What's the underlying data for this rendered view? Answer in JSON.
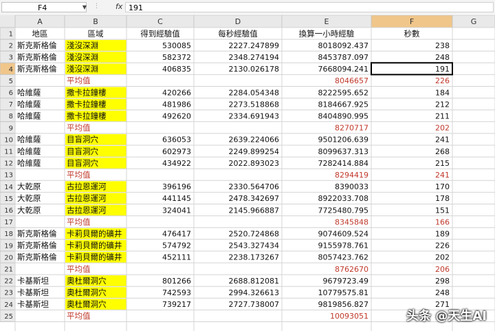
{
  "formula_bar": {
    "name_box": "F4",
    "function_icon": "fx-icon",
    "value": "191"
  },
  "columns": [
    "A",
    "B",
    "C",
    "D",
    "E",
    "F",
    "G"
  ],
  "header_row": [
    "地區",
    "區域",
    "得到經驗值",
    "每秒經驗值",
    "換算一小時經驗",
    "秒數"
  ],
  "rows": [
    {
      "n": "2",
      "a": "斯克斯格倫",
      "b": "淺沒深淵",
      "c": "530085",
      "d": "2227.247899",
      "e": "8018092.437",
      "f": "238",
      "type": "data"
    },
    {
      "n": "3",
      "a": "斯克斯格倫",
      "b": "淺沒深淵",
      "c": "582372",
      "d": "2348.274194",
      "e": "8453787.097",
      "f": "248",
      "type": "data"
    },
    {
      "n": "4",
      "a": "斯克斯格倫",
      "b": "淺沒深淵",
      "c": "406835",
      "d": "2130.026178",
      "e": "7668094.241",
      "f": "191",
      "type": "data"
    },
    {
      "n": "5",
      "a": "",
      "b": "平均值",
      "c": "",
      "d": "",
      "e": "8046657",
      "f": "226",
      "type": "avg"
    },
    {
      "n": "6",
      "a": "哈維薩",
      "b": "撒卡拉鐘樓",
      "c": "420266",
      "d": "2284.054348",
      "e": "8222595.652",
      "f": "184",
      "type": "data"
    },
    {
      "n": "7",
      "a": "哈維薩",
      "b": "撒卡拉鐘樓",
      "c": "481986",
      "d": "2273.518868",
      "e": "8184667.925",
      "f": "212",
      "type": "data"
    },
    {
      "n": "8",
      "a": "哈維薩",
      "b": "撒卡拉鐘樓",
      "c": "492620",
      "d": "2334.691943",
      "e": "8404890.995",
      "f": "211",
      "type": "data"
    },
    {
      "n": "9",
      "a": "",
      "b": "平均值",
      "c": "",
      "d": "",
      "e": "8270717",
      "f": "202",
      "type": "avg"
    },
    {
      "n": "10",
      "a": "哈維薩",
      "b": "目盲洞穴",
      "c": "636053",
      "d": "2639.224066",
      "e": "9501206.639",
      "f": "241",
      "type": "data"
    },
    {
      "n": "11",
      "a": "哈維薩",
      "b": "目盲洞穴",
      "c": "602973",
      "d": "2249.899254",
      "e": "8099637.313",
      "f": "268",
      "type": "data"
    },
    {
      "n": "12",
      "a": "哈維薩",
      "b": "目盲洞穴",
      "c": "434922",
      "d": "2022.893023",
      "e": "7282414.884",
      "f": "215",
      "type": "data"
    },
    {
      "n": "13",
      "a": "",
      "b": "平均值",
      "c": "",
      "d": "",
      "e": "8294419",
      "f": "241",
      "type": "avg"
    },
    {
      "n": "14",
      "a": "大乾原",
      "b": "古拉恩運河",
      "c": "396196",
      "d": "2330.564706",
      "e": "8390033",
      "f": "170",
      "type": "data"
    },
    {
      "n": "15",
      "a": "大乾原",
      "b": "古拉恩運河",
      "c": "441145",
      "d": "2478.342697",
      "e": "8922033.708",
      "f": "178",
      "type": "data"
    },
    {
      "n": "16",
      "a": "大乾原",
      "b": "古拉恩運河",
      "c": "324041",
      "d": "2145.966887",
      "e": "7725480.795",
      "f": "151",
      "type": "data"
    },
    {
      "n": "17",
      "a": "",
      "b": "平均值",
      "c": "",
      "d": "",
      "e": "8345848",
      "f": "166",
      "type": "avg"
    },
    {
      "n": "18",
      "a": "斯克斯格倫",
      "b": "卡莉貝爾的礦井",
      "c": "476417",
      "d": "2520.724868",
      "e": "9074609.524",
      "f": "189",
      "type": "data"
    },
    {
      "n": "19",
      "a": "斯克斯格倫",
      "b": "卡莉貝爾的礦井",
      "c": "574792",
      "d": "2543.327434",
      "e": "9155978.761",
      "f": "226",
      "type": "data"
    },
    {
      "n": "20",
      "a": "斯克斯格倫",
      "b": "卡莉貝爾的礦井",
      "c": "452111",
      "d": "2238.173267",
      "e": "8057423.762",
      "f": "202",
      "type": "data"
    },
    {
      "n": "21",
      "a": "",
      "b": "平均值",
      "c": "",
      "d": "",
      "e": "8762670",
      "f": "206",
      "type": "avg"
    },
    {
      "n": "22",
      "a": "卡基斯坦",
      "b": "奧杜爾洞穴",
      "c": "801266",
      "d": "2688.812081",
      "e": "9679723.49",
      "f": "298",
      "type": "data"
    },
    {
      "n": "23",
      "a": "卡基斯坦",
      "b": "奧杜爾洞穴",
      "c": "742593",
      "d": "2994.326613",
      "e": "10779575.81",
      "f": "248",
      "type": "data"
    },
    {
      "n": "24",
      "a": "卡基斯坦",
      "b": "奧杜爾洞穴",
      "c": "739217",
      "d": "2727.738007",
      "e": "9819856.827",
      "f": "271",
      "type": "data"
    },
    {
      "n": "25",
      "a": "",
      "b": "平均值",
      "c": "",
      "d": "",
      "e": "10093051",
      "f": "",
      "type": "avg"
    }
  ],
  "selected_cell": {
    "row": "4",
    "col": "F"
  },
  "watermark": "头条 @天生AI",
  "colors": {
    "highlight": "#ffff00",
    "avg_text": "#c0392b",
    "header_bg": "#e9e9e9",
    "grid": "#d4d4d4",
    "selected_header": "#f0c68a"
  }
}
